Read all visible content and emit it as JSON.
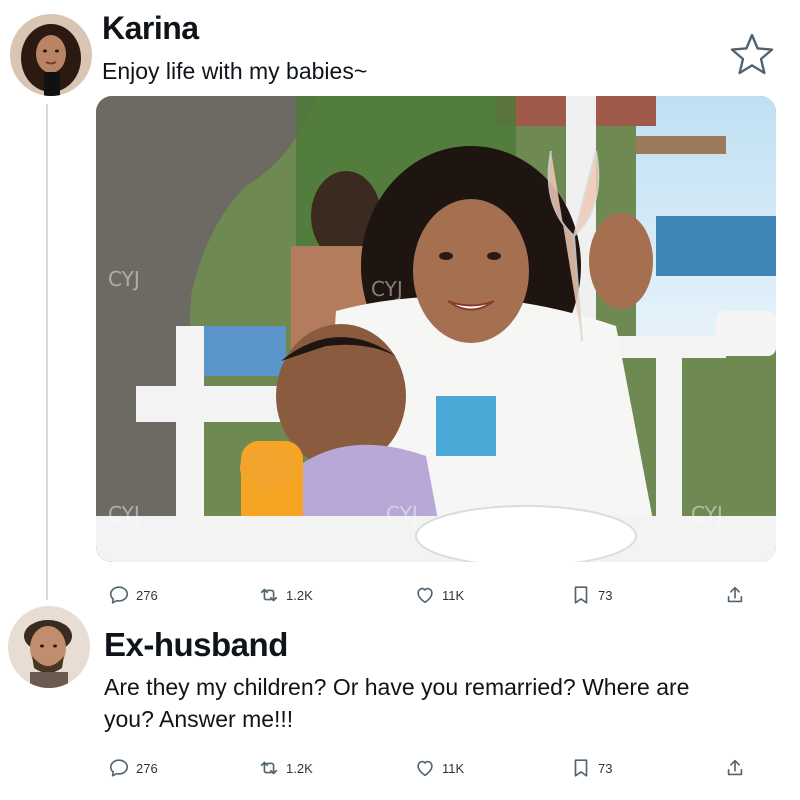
{
  "post": {
    "author": "Karina",
    "text": "Enjoy life with my babies~",
    "watermark": "CYJ",
    "icons": {
      "bookmark_star": "star-outline-icon"
    },
    "stats": {
      "replies": "276",
      "reposts": "1.2K",
      "likes": "11K",
      "bookmarks": "73"
    }
  },
  "reply": {
    "author": "Ex-husband",
    "text_line1": "Are they my children? Or have you remarried? Where are",
    "text_line2": "you? Answer me!!!",
    "stats": {
      "replies": "276",
      "reposts": "1.2K",
      "likes": "11K",
      "bookmarks": "73"
    }
  },
  "colors": {
    "thread_line": "#cfd9de",
    "icon": "#536471"
  }
}
